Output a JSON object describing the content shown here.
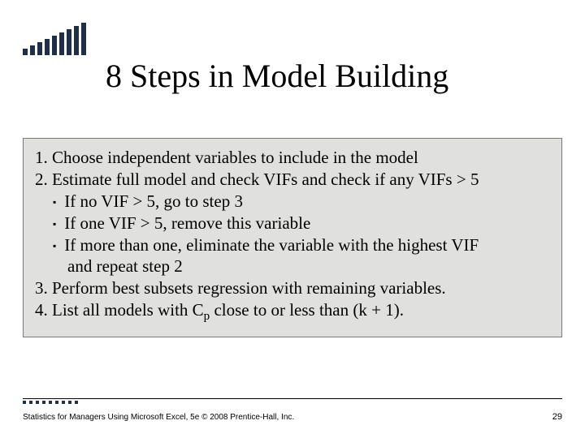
{
  "title": "8 Steps in Model Building",
  "steps": {
    "s1": "1. Choose independent variables to include in the model",
    "s2": "2. Estimate full model and check VIFs and check if any VIFs > 5",
    "s2a": "If no VIF > 5, go to step 3",
    "s2b": "If one VIF > 5, remove this variable",
    "s2c_line1": "If more than one, eliminate the variable with the highest VIF",
    "s2c_line2": "and repeat step 2",
    "s3": "3. Perform best subsets regression with remaining variables.",
    "s4_pre": "4. List all models with C",
    "s4_sub": "p",
    "s4_post": " close to or less than (k + 1)."
  },
  "footer": {
    "left": "Statistics for Managers Using Microsoft Excel, 5e © 2008 Prentice-Hall, Inc.",
    "page": "29"
  }
}
